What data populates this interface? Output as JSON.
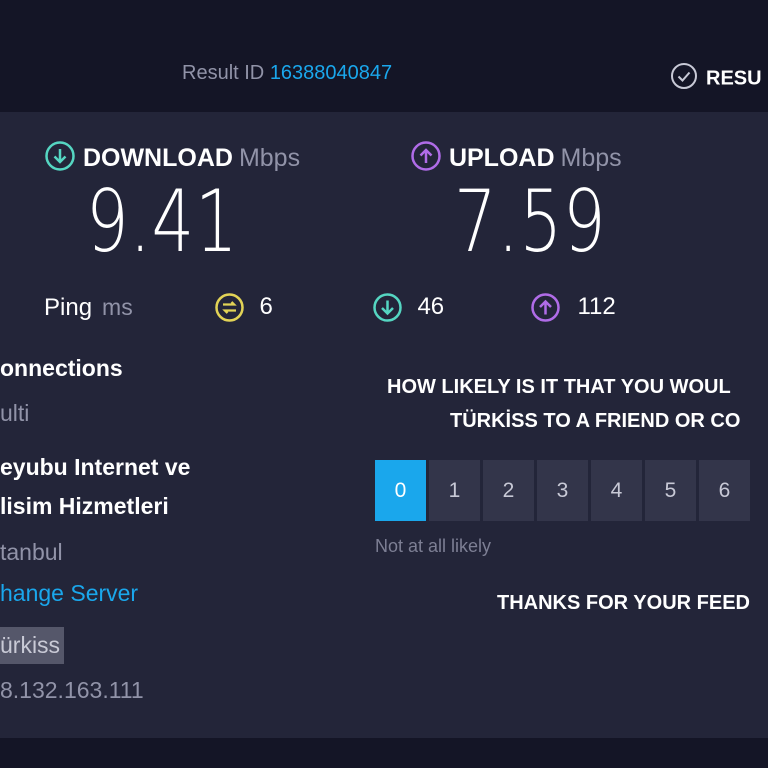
{
  "header": {
    "result_id_label": "Result ID",
    "result_id_value": "16388040847",
    "results_button_label": "RESU"
  },
  "metrics": {
    "download": {
      "label": "DOWNLOAD",
      "unit": "Mbps",
      "value": "9.41",
      "icon": "download-arrow-icon",
      "color": "#55d6c2"
    },
    "upload": {
      "label": "UPLOAD",
      "unit": "Mbps",
      "value": "7.59",
      "icon": "upload-arrow-icon",
      "color": "#b06ce8"
    }
  },
  "ping": {
    "label": "Ping",
    "unit": "ms",
    "idle": {
      "value": "6",
      "icon": "ping-jitter-icon",
      "color": "#e2d356"
    },
    "download": {
      "value": "46",
      "icon": "download-arrow-icon",
      "color": "#55d6c2"
    },
    "upload": {
      "value": "112",
      "icon": "upload-arrow-icon",
      "color": "#b06ce8"
    }
  },
  "connection": {
    "connections_label": "onnections",
    "connections_value": "ulti",
    "isp_line1": "eyubu Internet ve",
    "isp_line2": "lisim Hizmetleri",
    "location": "tanbul",
    "change_server": "hange Server",
    "host": "ürkiss",
    "ip": "8.132.163.111"
  },
  "survey": {
    "question_line1": "HOW LIKELY IS IT THAT YOU WOUL",
    "question_line2": "TÜRKİSS TO A FRIEND OR CO",
    "scale": [
      "0",
      "1",
      "2",
      "3",
      "4",
      "5",
      "6"
    ],
    "selected": "0",
    "low_label": "Not at all likely",
    "thanks": "THANKS FOR YOUR FEED"
  },
  "colors": {
    "accent": "#1aa7ec",
    "background": "#232539",
    "topbar": "#141526"
  }
}
